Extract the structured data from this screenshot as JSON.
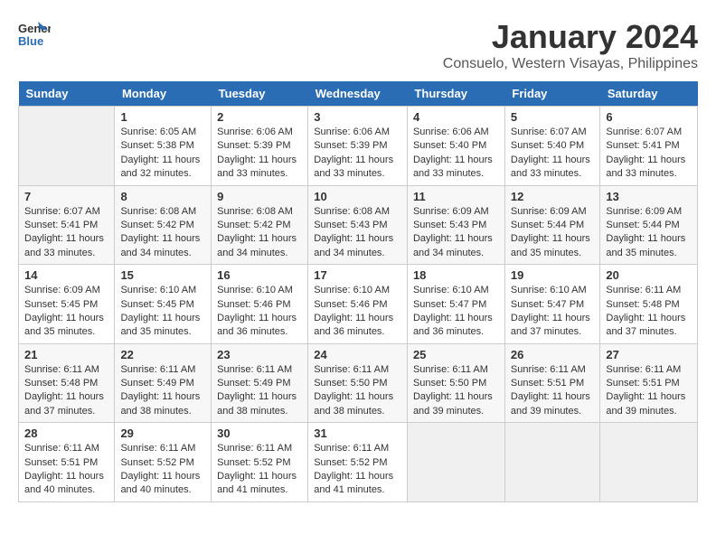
{
  "logo": {
    "general": "General",
    "blue": "Blue"
  },
  "title": "January 2024",
  "location": "Consuelo, Western Visayas, Philippines",
  "days_of_week": [
    "Sunday",
    "Monday",
    "Tuesday",
    "Wednesday",
    "Thursday",
    "Friday",
    "Saturday"
  ],
  "weeks": [
    [
      {
        "day": "",
        "info": ""
      },
      {
        "day": "1",
        "info": "Sunrise: 6:05 AM\nSunset: 5:38 PM\nDaylight: 11 hours\nand 32 minutes."
      },
      {
        "day": "2",
        "info": "Sunrise: 6:06 AM\nSunset: 5:39 PM\nDaylight: 11 hours\nand 33 minutes."
      },
      {
        "day": "3",
        "info": "Sunrise: 6:06 AM\nSunset: 5:39 PM\nDaylight: 11 hours\nand 33 minutes."
      },
      {
        "day": "4",
        "info": "Sunrise: 6:06 AM\nSunset: 5:40 PM\nDaylight: 11 hours\nand 33 minutes."
      },
      {
        "day": "5",
        "info": "Sunrise: 6:07 AM\nSunset: 5:40 PM\nDaylight: 11 hours\nand 33 minutes."
      },
      {
        "day": "6",
        "info": "Sunrise: 6:07 AM\nSunset: 5:41 PM\nDaylight: 11 hours\nand 33 minutes."
      }
    ],
    [
      {
        "day": "7",
        "info": "Sunrise: 6:07 AM\nSunset: 5:41 PM\nDaylight: 11 hours\nand 33 minutes."
      },
      {
        "day": "8",
        "info": "Sunrise: 6:08 AM\nSunset: 5:42 PM\nDaylight: 11 hours\nand 34 minutes."
      },
      {
        "day": "9",
        "info": "Sunrise: 6:08 AM\nSunset: 5:42 PM\nDaylight: 11 hours\nand 34 minutes."
      },
      {
        "day": "10",
        "info": "Sunrise: 6:08 AM\nSunset: 5:43 PM\nDaylight: 11 hours\nand 34 minutes."
      },
      {
        "day": "11",
        "info": "Sunrise: 6:09 AM\nSunset: 5:43 PM\nDaylight: 11 hours\nand 34 minutes."
      },
      {
        "day": "12",
        "info": "Sunrise: 6:09 AM\nSunset: 5:44 PM\nDaylight: 11 hours\nand 35 minutes."
      },
      {
        "day": "13",
        "info": "Sunrise: 6:09 AM\nSunset: 5:44 PM\nDaylight: 11 hours\nand 35 minutes."
      }
    ],
    [
      {
        "day": "14",
        "info": "Sunrise: 6:09 AM\nSunset: 5:45 PM\nDaylight: 11 hours\nand 35 minutes."
      },
      {
        "day": "15",
        "info": "Sunrise: 6:10 AM\nSunset: 5:45 PM\nDaylight: 11 hours\nand 35 minutes."
      },
      {
        "day": "16",
        "info": "Sunrise: 6:10 AM\nSunset: 5:46 PM\nDaylight: 11 hours\nand 36 minutes."
      },
      {
        "day": "17",
        "info": "Sunrise: 6:10 AM\nSunset: 5:46 PM\nDaylight: 11 hours\nand 36 minutes."
      },
      {
        "day": "18",
        "info": "Sunrise: 6:10 AM\nSunset: 5:47 PM\nDaylight: 11 hours\nand 36 minutes."
      },
      {
        "day": "19",
        "info": "Sunrise: 6:10 AM\nSunset: 5:47 PM\nDaylight: 11 hours\nand 37 minutes."
      },
      {
        "day": "20",
        "info": "Sunrise: 6:11 AM\nSunset: 5:48 PM\nDaylight: 11 hours\nand 37 minutes."
      }
    ],
    [
      {
        "day": "21",
        "info": "Sunrise: 6:11 AM\nSunset: 5:48 PM\nDaylight: 11 hours\nand 37 minutes."
      },
      {
        "day": "22",
        "info": "Sunrise: 6:11 AM\nSunset: 5:49 PM\nDaylight: 11 hours\nand 38 minutes."
      },
      {
        "day": "23",
        "info": "Sunrise: 6:11 AM\nSunset: 5:49 PM\nDaylight: 11 hours\nand 38 minutes."
      },
      {
        "day": "24",
        "info": "Sunrise: 6:11 AM\nSunset: 5:50 PM\nDaylight: 11 hours\nand 38 minutes."
      },
      {
        "day": "25",
        "info": "Sunrise: 6:11 AM\nSunset: 5:50 PM\nDaylight: 11 hours\nand 39 minutes."
      },
      {
        "day": "26",
        "info": "Sunrise: 6:11 AM\nSunset: 5:51 PM\nDaylight: 11 hours\nand 39 minutes."
      },
      {
        "day": "27",
        "info": "Sunrise: 6:11 AM\nSunset: 5:51 PM\nDaylight: 11 hours\nand 39 minutes."
      }
    ],
    [
      {
        "day": "28",
        "info": "Sunrise: 6:11 AM\nSunset: 5:51 PM\nDaylight: 11 hours\nand 40 minutes."
      },
      {
        "day": "29",
        "info": "Sunrise: 6:11 AM\nSunset: 5:52 PM\nDaylight: 11 hours\nand 40 minutes."
      },
      {
        "day": "30",
        "info": "Sunrise: 6:11 AM\nSunset: 5:52 PM\nDaylight: 11 hours\nand 41 minutes."
      },
      {
        "day": "31",
        "info": "Sunrise: 6:11 AM\nSunset: 5:52 PM\nDaylight: 11 hours\nand 41 minutes."
      },
      {
        "day": "",
        "info": ""
      },
      {
        "day": "",
        "info": ""
      },
      {
        "day": "",
        "info": ""
      }
    ]
  ]
}
